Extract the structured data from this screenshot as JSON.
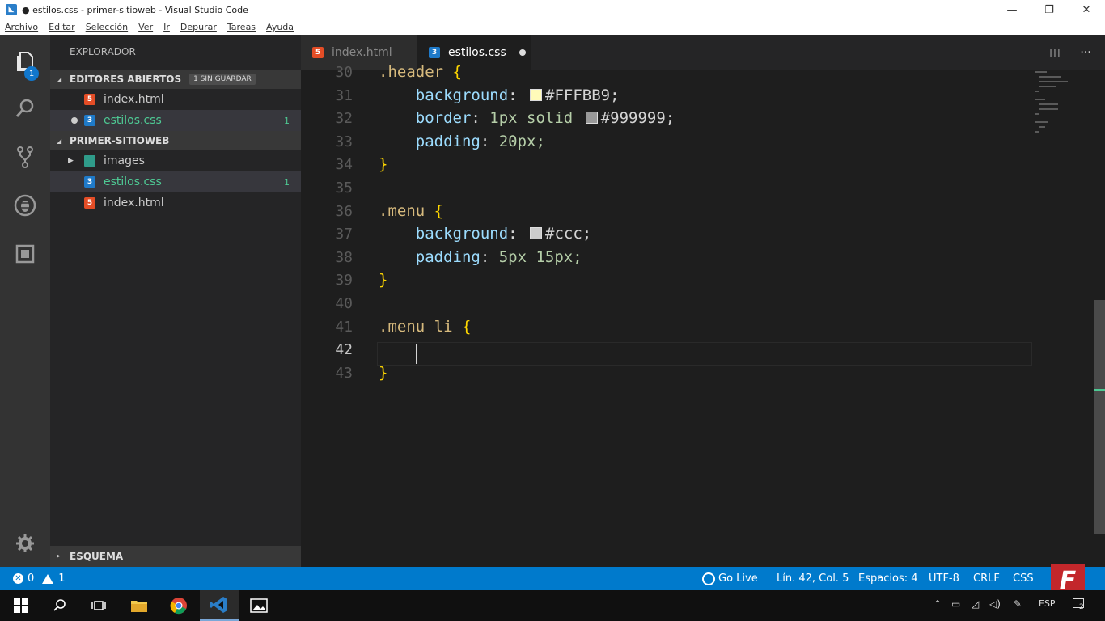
{
  "window": {
    "title": "● estilos.css - primer-sitioweb - Visual Studio Code",
    "controls": [
      "minimize",
      "restore",
      "close"
    ]
  },
  "menu": [
    "Archivo",
    "Editar",
    "Selección",
    "Ver",
    "Ir",
    "Depurar",
    "Tareas",
    "Ayuda"
  ],
  "activity": {
    "explorer_badge": "1",
    "icons": [
      "files-icon",
      "search-icon",
      "source-control-icon",
      "debug-icon",
      "extensions-icon",
      "gear-icon"
    ]
  },
  "sidebar": {
    "header": "EXPLORADOR",
    "open_editors": {
      "title": "EDITORES ABIERTOS",
      "badge": "1 SIN GUARDAR",
      "items": [
        {
          "name": "index.html",
          "type": "html"
        },
        {
          "name": "estilos.css",
          "type": "css",
          "count": "1"
        }
      ]
    },
    "project": {
      "title": "PRIMER-SITIOWEB",
      "items": [
        {
          "name": "images",
          "type": "folder"
        },
        {
          "name": "estilos.css",
          "type": "css",
          "count": "1"
        },
        {
          "name": "index.html",
          "type": "html"
        }
      ]
    },
    "outline": "ESQUEMA"
  },
  "tabs": [
    {
      "label": "index.html",
      "type": "html"
    },
    {
      "label": "estilos.css",
      "type": "css",
      "modified": true
    }
  ],
  "editor": {
    "current_line": 42,
    "lines": [
      {
        "n": "30",
        "selector": ".header",
        "brace": "{"
      },
      {
        "n": "31",
        "prop": "background",
        "swatch": "#FFFBB9",
        "value": "#FFFBB9;"
      },
      {
        "n": "32",
        "prop": "border",
        "pre": "1px solid",
        "swatch": "#999999",
        "value": "#999999;"
      },
      {
        "n": "33",
        "prop": "padding",
        "value": "20px;"
      },
      {
        "n": "34",
        "close": "}"
      },
      {
        "n": "35"
      },
      {
        "n": "36",
        "selector": ".menu",
        "brace": "{"
      },
      {
        "n": "37",
        "prop": "background",
        "swatch": "#cccccc",
        "value": "#ccc;"
      },
      {
        "n": "38",
        "prop": "padding",
        "value": "5px 15px;"
      },
      {
        "n": "39",
        "close": "}"
      },
      {
        "n": "40"
      },
      {
        "n": "41",
        "selector": ".menu li",
        "brace": "{"
      },
      {
        "n": "42"
      },
      {
        "n": "43",
        "close": "}"
      }
    ]
  },
  "status": {
    "errors": "0",
    "warnings": "1",
    "golive": "Go Live",
    "position": "Lín. 42, Col. 5",
    "spaces": "Espacios: 4",
    "encoding": "UTF-8",
    "eol": "CRLF",
    "language": "CSS"
  },
  "taskbar": {
    "tray_lang": "ESP",
    "notifications": "2"
  },
  "colors": {
    "accent": "#007acc",
    "selector": "#d7ba7d",
    "property": "#9cdcfe",
    "number": "#b5cea8",
    "brace": "#ffd700",
    "git_modified": "#4ec994"
  }
}
